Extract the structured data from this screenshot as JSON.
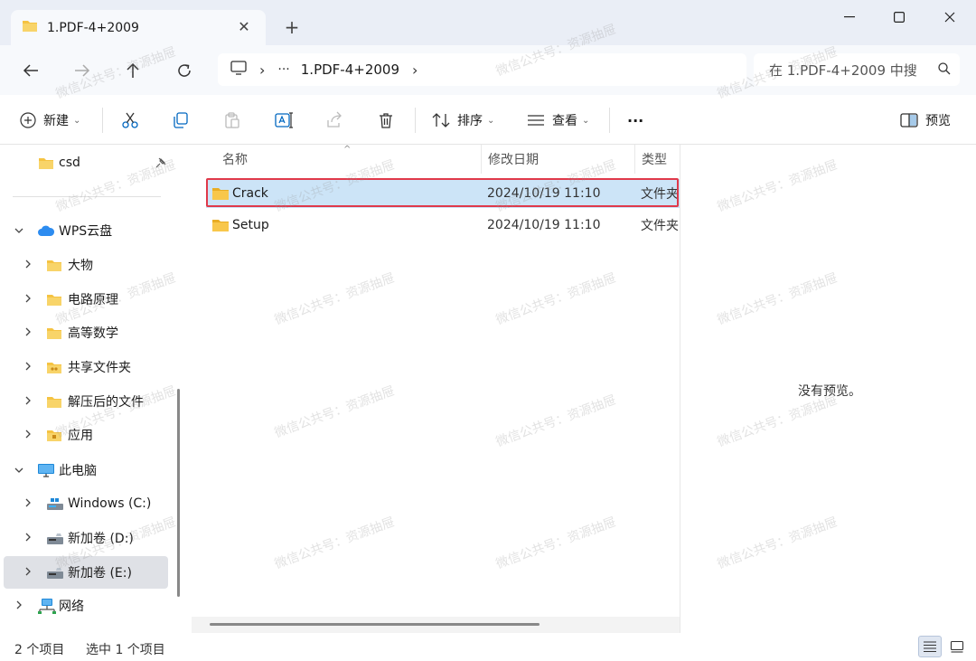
{
  "window": {
    "tab_title": "1.PDF-4+2009",
    "tab_close": "✕",
    "new_tab": "+",
    "minimize": "—",
    "maximize": "☐",
    "close": "✕"
  },
  "address": {
    "chevron": "›",
    "ellipsis": "···",
    "path": "1.PDF-4+2009",
    "search_placeholder": "在 1.PDF-4+2009 中搜"
  },
  "toolbar": {
    "new_label": "新建",
    "sort_label": "排序",
    "view_label": "查看",
    "more": "···",
    "preview_label": "预览",
    "caret": "⌄"
  },
  "sidebar": {
    "items": [
      {
        "label": "csd",
        "icon": "folder-icon",
        "indent": 0
      },
      {
        "label": "WPS云盘",
        "icon": "cloud-icon",
        "indent": 0
      },
      {
        "label": "大物",
        "icon": "folder-icon",
        "indent": 1
      },
      {
        "label": "电路原理",
        "icon": "folder-icon",
        "indent": 1
      },
      {
        "label": "高等数学",
        "icon": "folder-icon",
        "indent": 1
      },
      {
        "label": "共享文件夹",
        "icon": "shared-folder-icon",
        "indent": 1
      },
      {
        "label": "解压后的文件",
        "icon": "folder-icon",
        "indent": 1
      },
      {
        "label": "应用",
        "icon": "app-folder-icon",
        "indent": 1
      },
      {
        "label": "此电脑",
        "icon": "pc-icon",
        "indent": 0
      },
      {
        "label": "Windows (C:)",
        "icon": "drive-c-icon",
        "indent": 1
      },
      {
        "label": "新加卷 (D:)",
        "icon": "drive-icon",
        "indent": 1
      },
      {
        "label": "新加卷 (E:)",
        "icon": "drive-icon",
        "indent": 1
      },
      {
        "label": "网络",
        "icon": "network-icon",
        "indent": 0
      }
    ]
  },
  "filelist": {
    "columns": {
      "name": "名称",
      "date": "修改日期",
      "type": "类型"
    },
    "sort_caret": "^",
    "rows": [
      {
        "name": "Crack",
        "date": "2024/10/19 11:10",
        "type": "文件夹"
      },
      {
        "name": "Setup",
        "date": "2024/10/19 11:10",
        "type": "文件夹"
      }
    ]
  },
  "preview": {
    "empty_text": "没有预览。"
  },
  "status": {
    "item_count": "2 个项目",
    "selected_count": "选中 1 个项目"
  },
  "watermark": "微信公共号：资源抽屉",
  "colors": {
    "accent": "#0067c0",
    "selection": "#cce4f7",
    "highlight_border": "#e0394a",
    "folder": "#f5c342"
  }
}
